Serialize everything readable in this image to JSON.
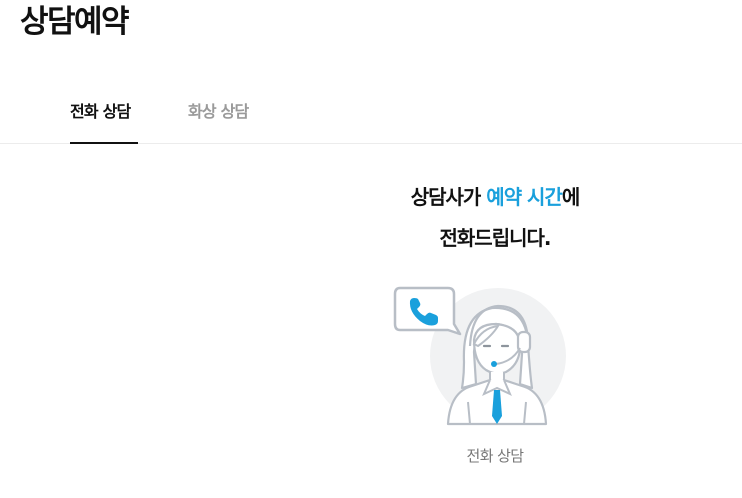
{
  "page": {
    "title": "상담예약"
  },
  "tabs": [
    {
      "label": "전화 상담",
      "active": true
    },
    {
      "label": "화상 상담",
      "active": false
    }
  ],
  "headline": {
    "line1_prefix": "상담사가 ",
    "line1_highlight": "예약 시간",
    "line1_suffix": "에",
    "line2": "전화드립니다."
  },
  "illustration": {
    "icon": "phone-consultant-icon",
    "caption": "전화 상담"
  },
  "colors": {
    "accent": "#1aa0dc",
    "text": "#111111",
    "muted": "#9a9a9a"
  }
}
